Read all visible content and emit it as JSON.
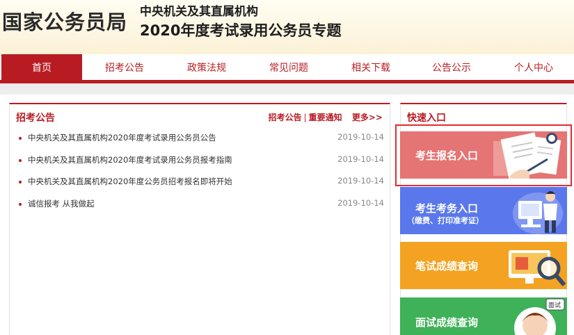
{
  "header": {
    "site_name": "国家公务员局",
    "topic_line1": "中央机关及其直属机构",
    "topic_line2": "2020年度考试录用公务员专题"
  },
  "nav": {
    "items": [
      "首页",
      "招考公告",
      "政策法规",
      "常见问题",
      "相关下载",
      "公告公示",
      "个人中心"
    ],
    "active_index": 0
  },
  "announcements": {
    "title": "招考公告",
    "links": [
      "招考公告",
      "重要通知"
    ],
    "separator": "|",
    "more": "更多>>",
    "items": [
      {
        "title": "中央机关及其直属机构2020年度考试录用公务员公告",
        "date": "2019-10-14"
      },
      {
        "title": "中央机关及其直属机构2020年度考试录用公务员报考指南",
        "date": "2019-10-14"
      },
      {
        "title": "中央机关及其直属机构2020年度公务员招考报名即将开始",
        "date": "2019-10-14"
      },
      {
        "title": "诚信报考  从我做起",
        "date": "2019-10-14"
      }
    ]
  },
  "quick": {
    "title": "快速入口",
    "tiles": [
      {
        "label": "考生报名入口",
        "icon": "application-form-icon",
        "color": "#e57474"
      },
      {
        "label": "考生考务入口",
        "sub": "（缴费、打印准考证）",
        "icon": "computer-user-icon",
        "color": "#5a78ec"
      },
      {
        "label": "笔试成绩查询",
        "icon": "screen-magnifier-icon",
        "color": "#f3a321"
      },
      {
        "label": "面试成绩查询",
        "icon": "interviewer-icon",
        "badge": "面试",
        "color": "#3fb159"
      }
    ]
  },
  "colors": {
    "brand_red": "#b81c22",
    "highlight": "#e32b30"
  }
}
